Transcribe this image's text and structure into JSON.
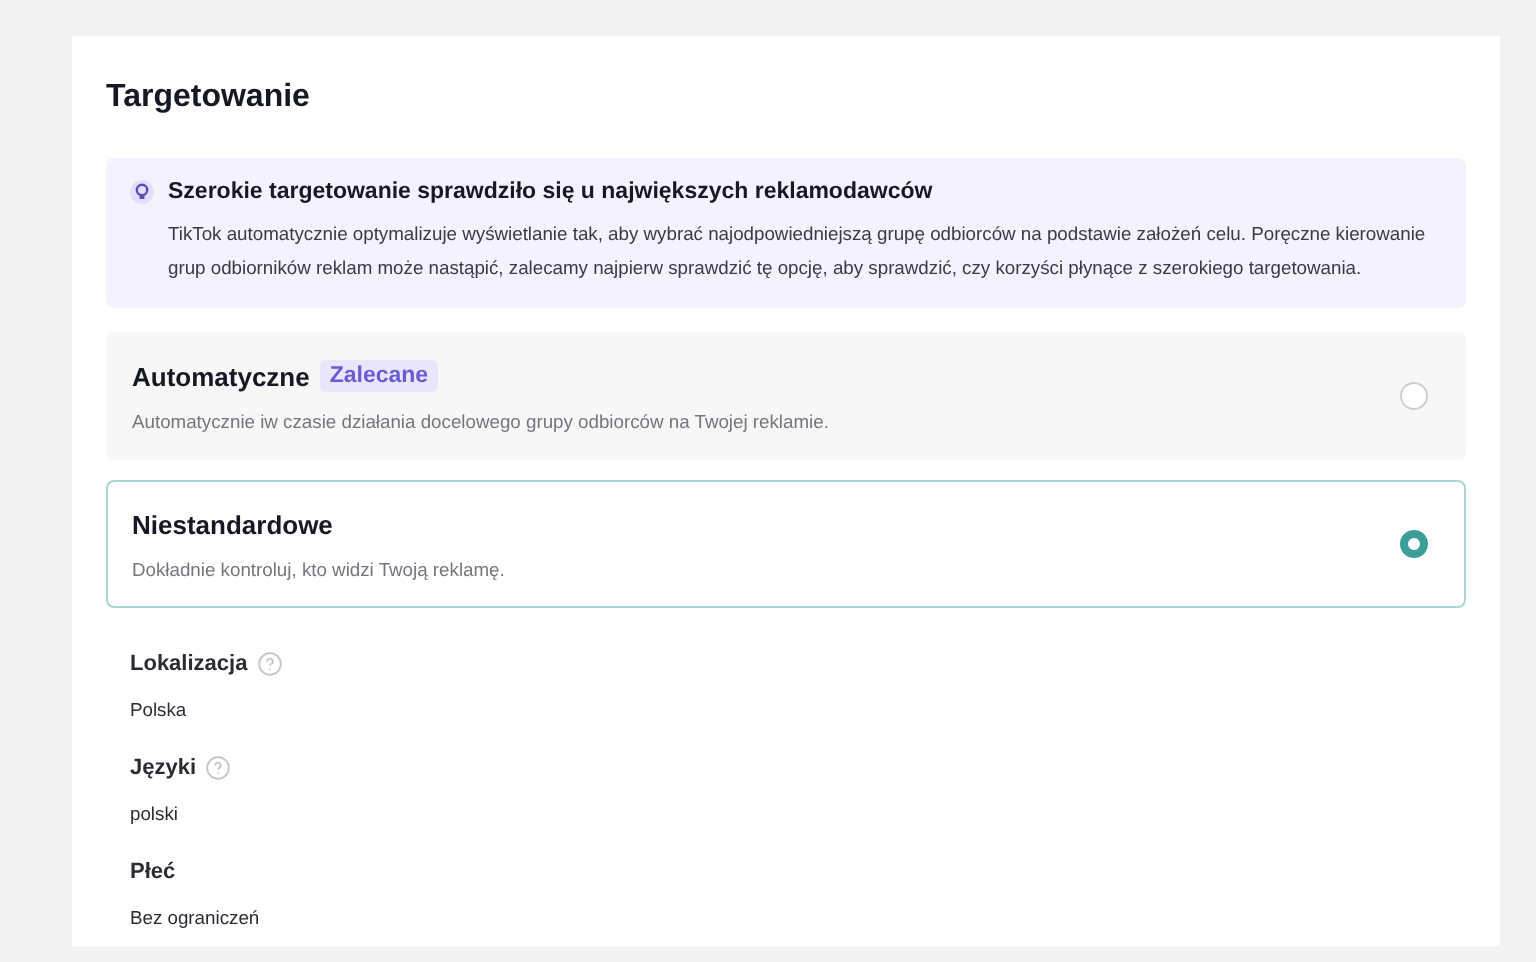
{
  "section": {
    "title": "Targetowanie"
  },
  "banner": {
    "title": "Szerokie targetowanie sprawdziło się u największych reklamodawców",
    "text": "TikTok automatycznie optymalizuje wyświetlanie tak, aby wybrać najodpowiedniejszą grupę odbiorców na podstawie założeń celu. Poręczne kierowanie grup odbiorników reklam może nastąpić, zalecamy najpierw sprawdzić tę opcję, aby sprawdzić, czy korzyści płynące z szerokiego targetowania."
  },
  "options": [
    {
      "title": "Automatyczne",
      "badge": "Zalecane",
      "description": "Automatycznie iw czasie działania docelowego grupy odbiorców na Twojej reklamie.",
      "selected": false
    },
    {
      "title": "Niestandardowe",
      "description": "Dokładnie kontroluj, kto widzi Twoją reklamę.",
      "selected": true
    }
  ],
  "fields": [
    {
      "label": "Lokalizacja",
      "help": true,
      "value": "Polska"
    },
    {
      "label": "Języki",
      "help": true,
      "value": "polski"
    },
    {
      "label": "Płeć",
      "help": false,
      "value": "Bez ograniczeń"
    }
  ]
}
